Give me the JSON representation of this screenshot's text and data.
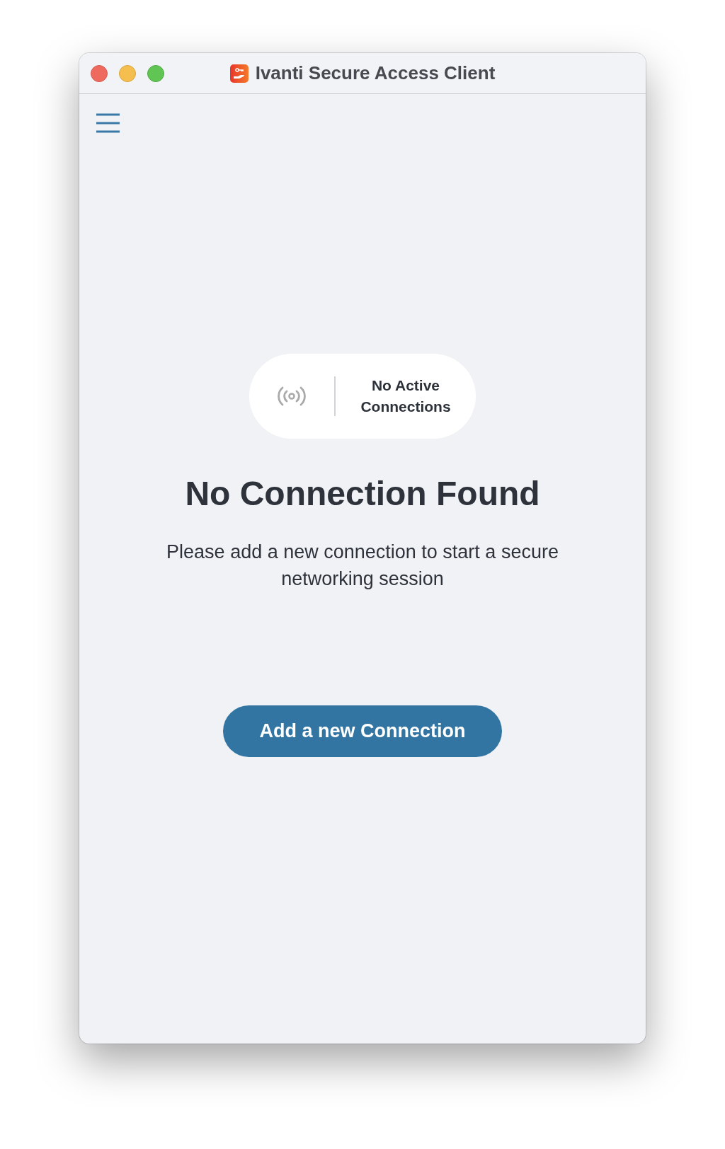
{
  "window": {
    "title": "Ivanti Secure Access Client"
  },
  "status_pill": {
    "label": "No Active Connections"
  },
  "heading": "No Connection Found",
  "message": "Please add a new connection to start a secure networking session",
  "primary_button": {
    "label": "Add a new Connection"
  }
}
